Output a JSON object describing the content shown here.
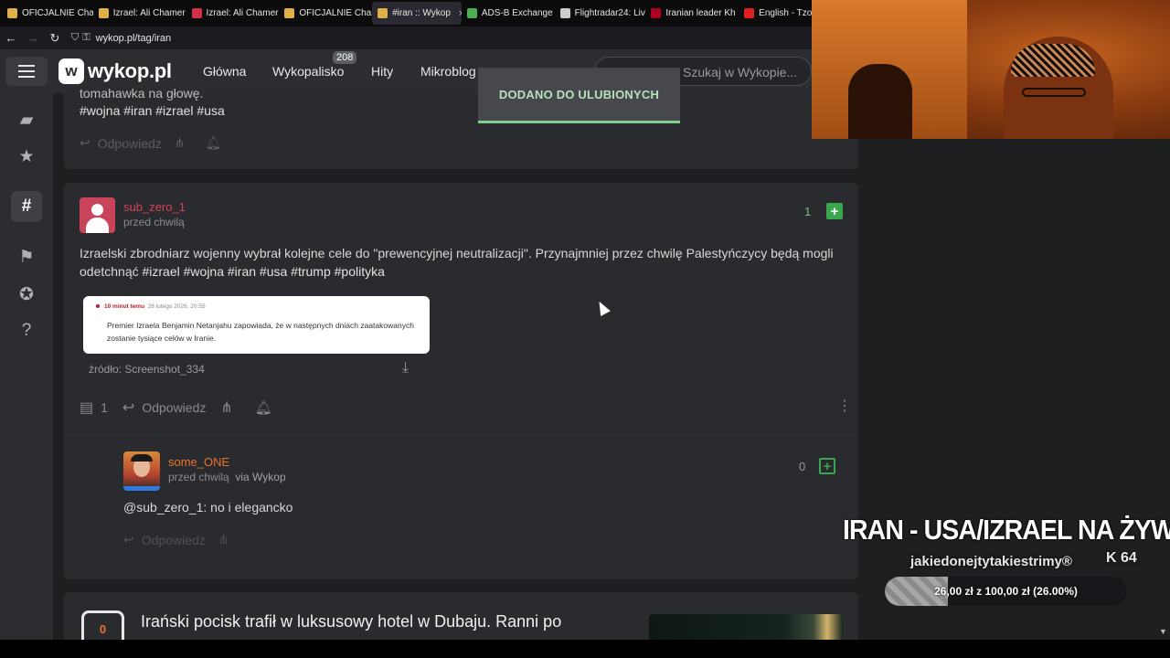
{
  "browser": {
    "tabs": [
      {
        "label": "OFICJALNIE Cham",
        "color": "#e0b04a"
      },
      {
        "label": "Izrael: Ali Chamer",
        "color": "#e0b04a"
      },
      {
        "label": "Izrael: Ali Chamer",
        "color": "#d0304a"
      },
      {
        "label": "OFICJALNIE Cham",
        "color": "#e0b04a"
      },
      {
        "label": "#iran :: Wykop",
        "color": "#e0b04a",
        "active": true
      },
      {
        "label": "ADS-B Exchange",
        "color": "#4caf50"
      },
      {
        "label": "Flightradar24: Liv",
        "color": "#cccccc"
      },
      {
        "label": "Iranian leader Kh",
        "color": "#b00020"
      },
      {
        "label": "English - Tzo",
        "color": "#e02020"
      }
    ],
    "tab_close": "×",
    "url": "wykop.pl/tag/iran"
  },
  "site": {
    "logo_mark": "w",
    "logo_text": "wykop.pl",
    "nav": {
      "glowna": "Główna",
      "wykopalisko": "Wykopalisko",
      "wykopalisko_count": "208",
      "hity": "Hity",
      "mikroblog": "Mikroblog"
    },
    "search_placeholder": "Szukaj w Wykopie..."
  },
  "toast": "DODANO DO ULUBIONYCH",
  "feed": {
    "post0": {
      "partial_text": "tomahawka na głowę.",
      "tags": "#wojna #iran #izrael #usa",
      "reply": "Odpowiedz"
    },
    "post1": {
      "author": "sub_zero_1",
      "time": "przed chwilą",
      "votes": "1",
      "text": "Izraelski zbrodniarz wojenny wybrał kolejne cele do \"prewencyjnej neutralizacji\". Przynajmniej przez chwilę Palestyńczycy będą mogli odetchnąć",
      "tags": "#izrael #wojna #iran #usa #trump #polityka",
      "embed": {
        "time": "10 minut temu",
        "date": "28 lutego 2026, 20:55",
        "text": "Premier Izraela Benjamin Netanjahu zapowiada, że w następnych dniach zaatakowanych zostanie tysiące celów w Iranie."
      },
      "source": "źródło: Screenshot_334",
      "comments": "1",
      "reply": "Odpowiedz"
    },
    "comment1": {
      "author": "some_ONE",
      "time": "przed chwilą",
      "via": "via Wykop",
      "votes": "0",
      "mention": "@sub_zero_1",
      "text": ": no i elegancko",
      "reply": "Odpowiedz"
    },
    "link1": {
      "votes": "0",
      "title": "Irański pocisk trafił w luksusowy hotel w Dubaju. Ranni po"
    }
  },
  "stream": {
    "title": "IRAN - USA/IZRAEL NA ŻYWO",
    "channel": "jakiedonejtytakiestrimy®",
    "kick_count": "64",
    "goal_text": "26,00 zł z 100,00 zł (26.00%)",
    "goal_fraction": 0.26
  }
}
